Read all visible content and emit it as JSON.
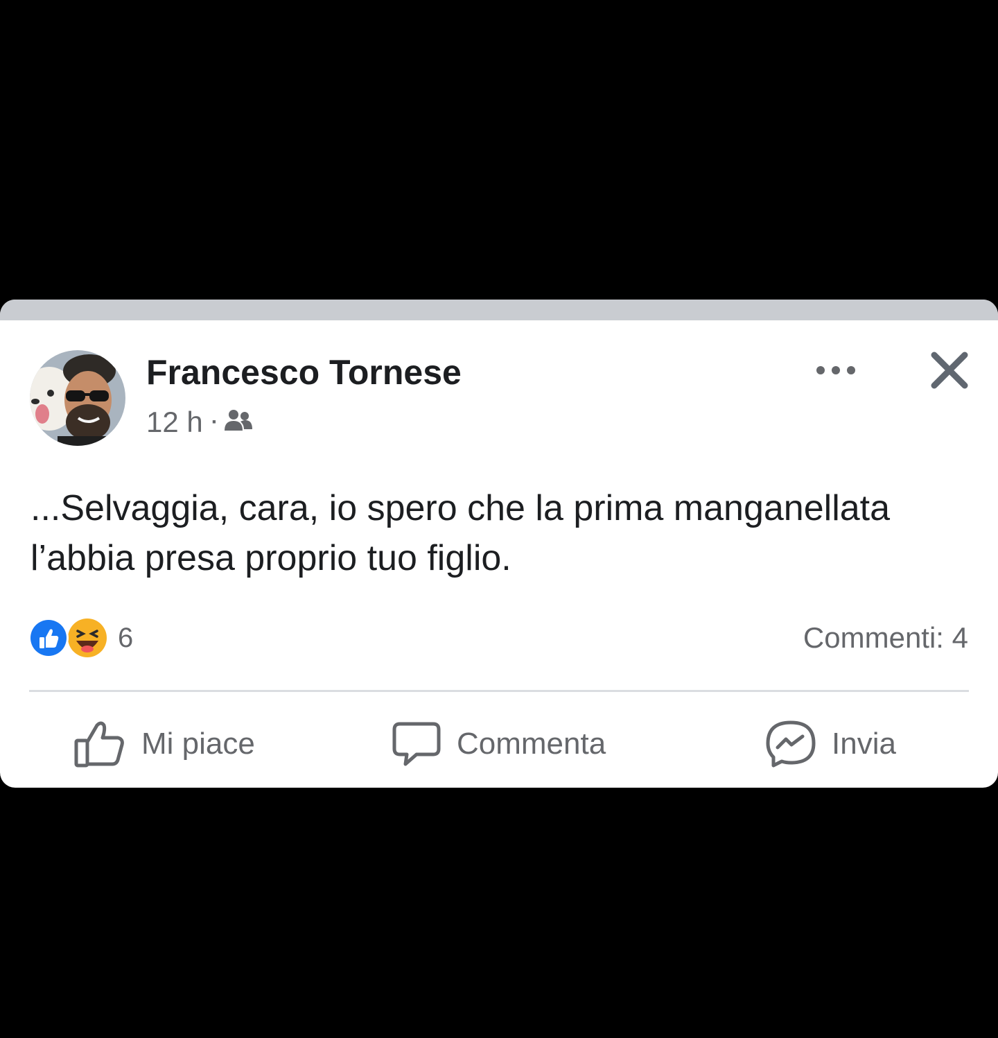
{
  "post": {
    "author_name": "Francesco Tornese",
    "time": "12 h",
    "separator": "·",
    "audience_icon": "friends-icon",
    "text": "...Selvaggia, cara, io spero che la prima manganellata l’abbia presa proprio tuo figlio.",
    "more_icon": "more-options-icon",
    "close_icon": "close-icon"
  },
  "reactions": {
    "icons": [
      "like-reaction-icon",
      "haha-reaction-icon"
    ],
    "count": "6"
  },
  "comments_label": "Commenti: 4",
  "actions": {
    "like_label": "Mi piace",
    "comment_label": "Commenta",
    "send_label": "Invia"
  },
  "colors": {
    "background": "#000000",
    "card": "#ffffff",
    "top_strip": "#c9ccd1",
    "primary_text": "#1c1e21",
    "secondary_text": "#65676b",
    "like_blue": "#1877f2",
    "haha_yellow": "#f7b125",
    "divider": "#dadde1"
  }
}
